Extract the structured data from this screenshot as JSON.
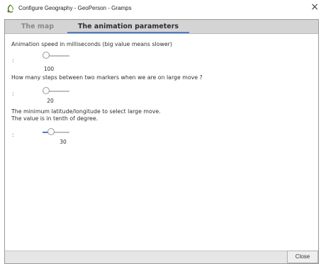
{
  "window": {
    "title": "Configure Geography - GeoPerson - Gramps",
    "close_glyph": "×",
    "app_icon": "gramps-icon"
  },
  "tabs": [
    {
      "label": "The map",
      "active": false
    },
    {
      "label": "The animation parameters",
      "active": true
    }
  ],
  "settings": [
    {
      "label": "Animation speed in milliseconds (big value means slower)",
      "colon": ":",
      "value": "100",
      "fraction": 0.0
    },
    {
      "label": "How many steps between two markers when we are on large move ?",
      "colon": ":",
      "value": "20",
      "fraction": 0.0
    },
    {
      "label_line1": "The minimum latitude/longitude to select large move.",
      "label_line2": "The value is in tenth of degree.",
      "colon": ":",
      "value": "30",
      "fraction": 0.25
    }
  ],
  "footer": {
    "close_label": "Close"
  },
  "colors": {
    "accent": "#4a7fc6",
    "tab_bar": "#d4d4d4"
  }
}
